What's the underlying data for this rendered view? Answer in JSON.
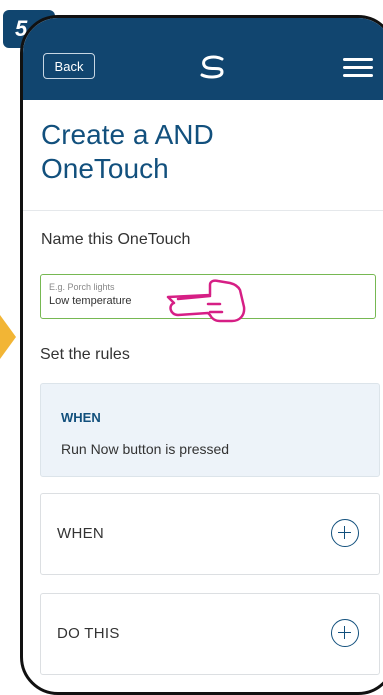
{
  "step": {
    "number": "5"
  },
  "header": {
    "back_label": "Back",
    "logo_icon": "salus-logo-icon",
    "menu_icon": "hamburger-menu-icon"
  },
  "page": {
    "title_line1": "Create a AND",
    "title_line2": "OneTouch"
  },
  "name_section": {
    "label": "Name this OneTouch",
    "placeholder": "E.g. Porch lights",
    "value": "Low temperature"
  },
  "rules_section": {
    "label": "Set the rules",
    "rule": {
      "heading": "WHEN",
      "text": "Run Now button is pressed"
    }
  },
  "cards": [
    {
      "label": "WHEN",
      "icon": "add-icon"
    },
    {
      "label": "DO THIS",
      "icon": "add-icon"
    }
  ],
  "colors": {
    "brand": "#11456f",
    "accent_green": "#76b852",
    "hint_arrow": "#f2b535",
    "rule_bg": "#edf3f9"
  }
}
